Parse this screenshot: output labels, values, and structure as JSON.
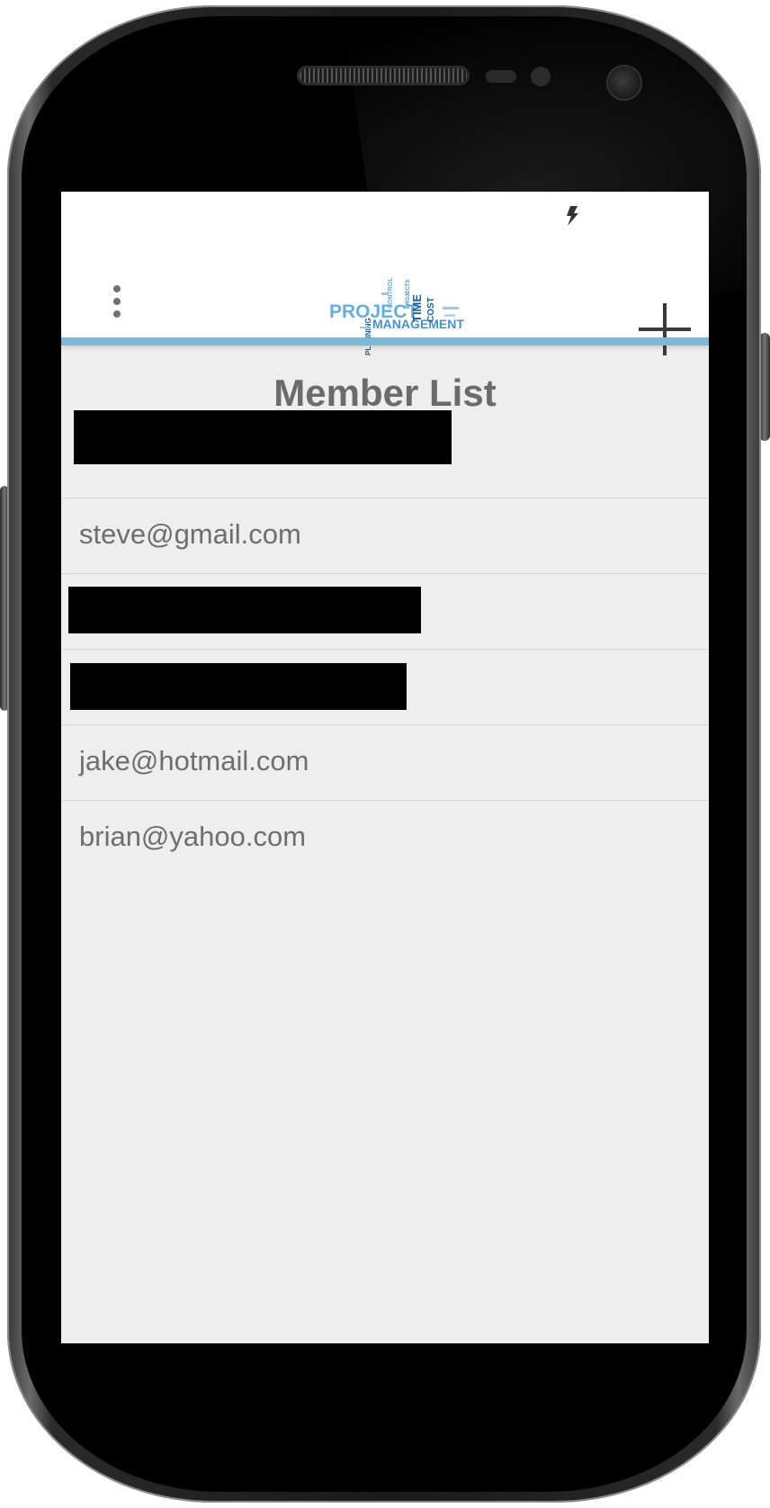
{
  "screen": {
    "title": "Member List",
    "logo": {
      "words": [
        "PROJECT",
        "MANAGEMENT",
        "TIME",
        "COST",
        "PLANNING",
        "CONTROL",
        "PROJECTS"
      ]
    },
    "icons": {
      "menu": "more-vert-icon",
      "add": "add-icon",
      "status": "bolt-icon"
    },
    "members": [
      {
        "email": "",
        "redacted": true
      },
      {
        "email": "steve@gmail.com",
        "redacted": false
      },
      {
        "email": "",
        "redacted": true
      },
      {
        "email": "",
        "redacted": true
      },
      {
        "email": "jake@hotmail.com",
        "redacted": false
      },
      {
        "email": "brian@yahoo.com",
        "redacted": false
      }
    ]
  },
  "colors": {
    "accent": "#7db8d6",
    "background": "#eeeeee",
    "title_text": "#6b6b6b",
    "logo_light_blue": "#6aaed6",
    "logo_dark_blue": "#1f5f94"
  }
}
